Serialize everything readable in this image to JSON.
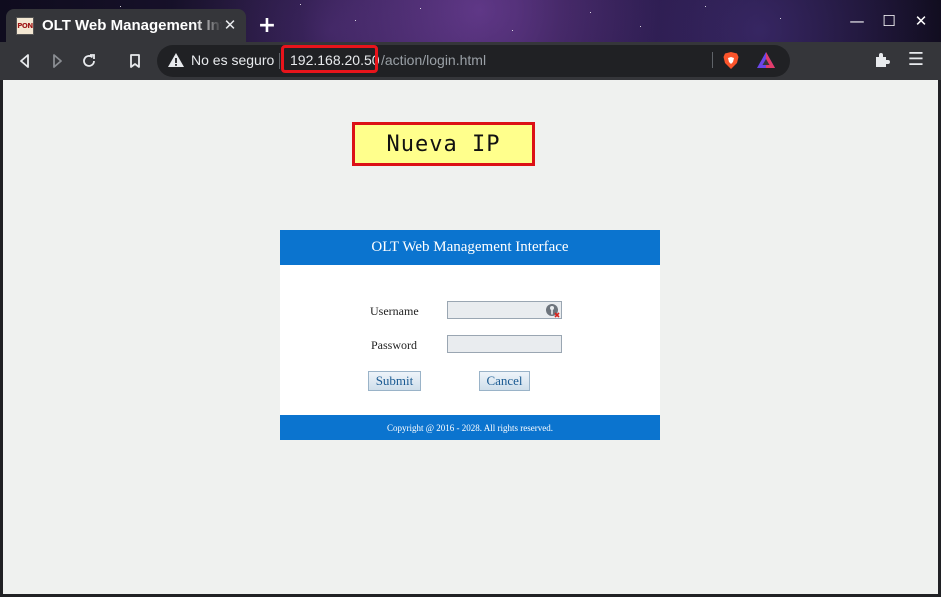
{
  "browser": {
    "tab": {
      "title": "OLT Web Management Interface",
      "favicon_text": "PON"
    },
    "new_tab_glyph": "+",
    "window_controls": {
      "minimize": "—",
      "maximize": "☐",
      "close": "✕"
    },
    "address_bar": {
      "security_text": "No es seguro",
      "url_host": "192.168.20.50",
      "url_path": "/action/login.html"
    },
    "icons": [
      "back-icon",
      "forward-icon",
      "reload-icon",
      "bookmark-icon",
      "warning-icon",
      "brave-shields-icon",
      "brave-rewards-icon",
      "extensions-icon",
      "menu-icon"
    ]
  },
  "annotation": {
    "label": "Nueva IP",
    "highlight_color": "#e8141b",
    "background": "#ffff8c"
  },
  "login": {
    "header": "OLT Web Management Interface",
    "username_label": "Username",
    "username_value": "",
    "password_label": "Password",
    "password_value": "",
    "submit_label": "Submit",
    "cancel_label": "Cancel",
    "footer": "Copyright @ 2016 - 2028. All rights reserved."
  },
  "colors": {
    "brand_blue": "#0b74cf",
    "page_bg": "#eff1ef",
    "chrome_dark": "#35363a"
  }
}
